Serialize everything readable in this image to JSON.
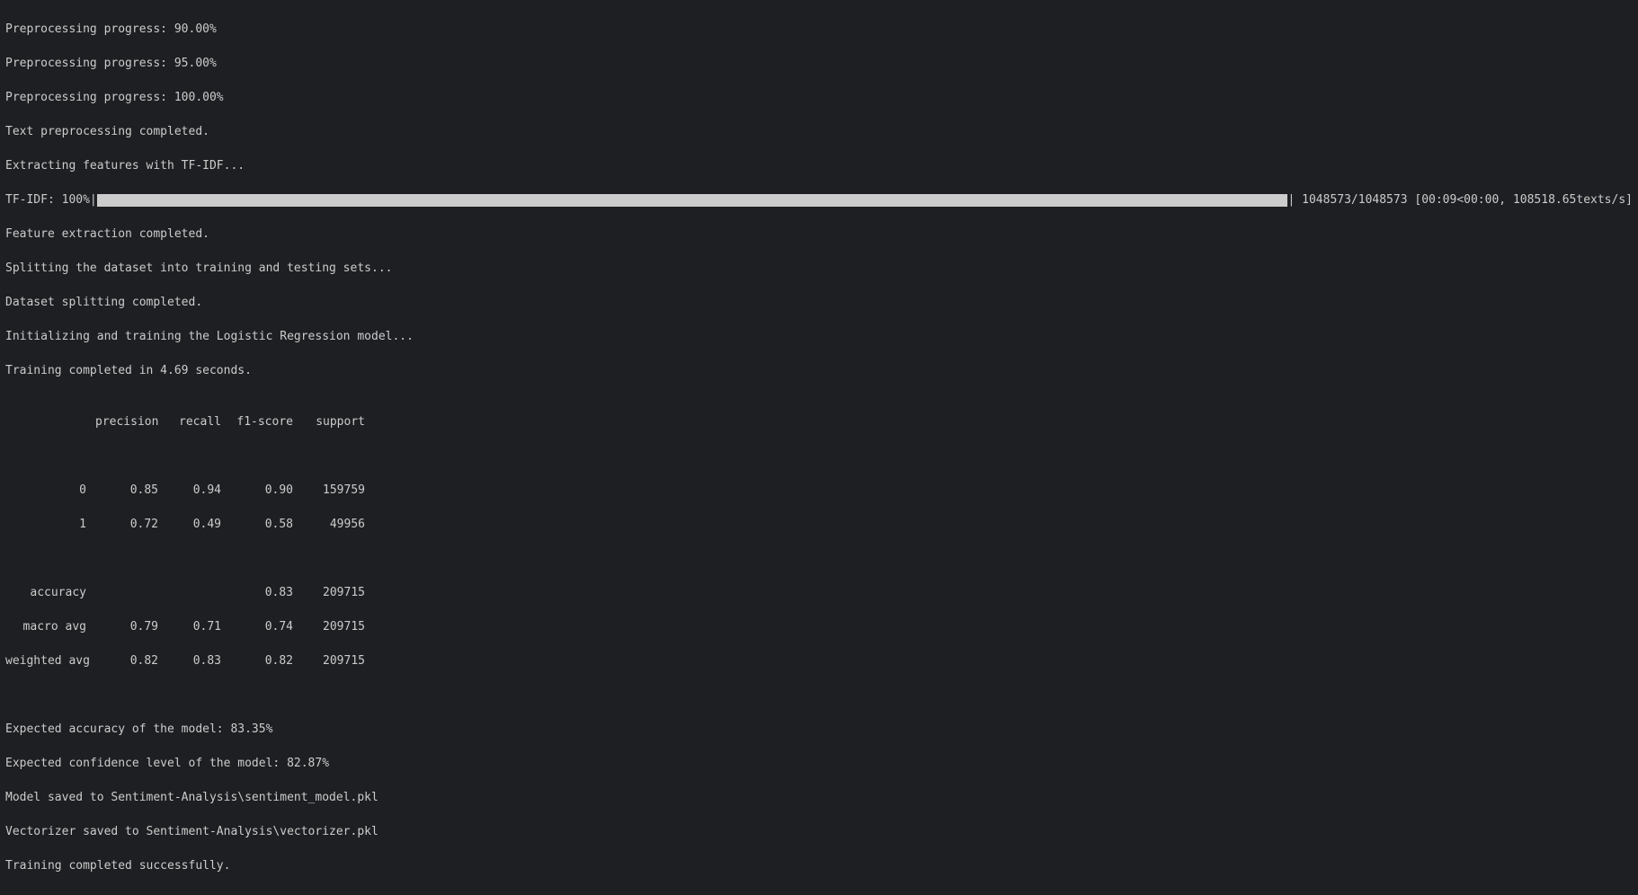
{
  "lines": {
    "prog90": "Preprocessing progress: 90.00%",
    "prog95": "Preprocessing progress: 95.00%",
    "prog100": "Preprocessing progress: 100.00%",
    "text_done": "Text preprocessing completed.",
    "extracting": "Extracting features with TF-IDF...",
    "tfidf_label": "TF-IDF: 100%|",
    "tfidf_end": "| 1048573/1048573 [00:09<00:00, 108518.65texts/s]",
    "feat_done": "Feature extraction completed.",
    "splitting": "Splitting the dataset into training and testing sets...",
    "split_done": "Dataset splitting completed.",
    "init_train": "Initializing and training the Logistic Regression model...",
    "train_done": "Training completed in 4.69 seconds.",
    "exp_acc": "Expected accuracy of the model: 83.35%",
    "exp_conf": "Expected confidence level of the model: 82.87%",
    "model_saved": "Model saved to Sentiment-Analysis\\sentiment_model.pkl",
    "vect_saved": "Vectorizer saved to Sentiment-Analysis\\vectorizer.pkl",
    "all_done": "Training completed successfully."
  },
  "report": {
    "header": {
      "precision": "precision",
      "recall": "recall",
      "f1": "f1-score",
      "support": "support"
    },
    "rows": [
      {
        "label": "0",
        "precision": "0.85",
        "recall": "0.94",
        "f1": "0.90",
        "support": "159759"
      },
      {
        "label": "1",
        "precision": "0.72",
        "recall": "0.49",
        "f1": "0.58",
        "support": "49956"
      }
    ],
    "accuracy": {
      "label": "accuracy",
      "f1": "0.83",
      "support": "209715"
    },
    "macro": {
      "label": "macro avg",
      "precision": "0.79",
      "recall": "0.71",
      "f1": "0.74",
      "support": "209715"
    },
    "weighted": {
      "label": "weighted avg",
      "precision": "0.82",
      "recall": "0.83",
      "f1": "0.82",
      "support": "209715"
    }
  }
}
